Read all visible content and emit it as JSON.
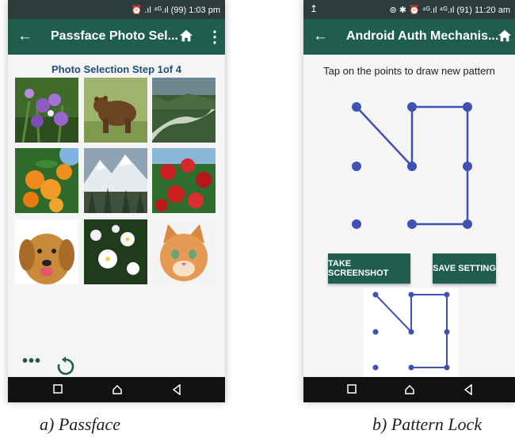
{
  "passface": {
    "status_text": "⏰ .ıl ⁴ᴳ.ıl (99) 1:03 pm",
    "title": "Passface Photo Sel...",
    "step_title": "Photo Selection Step 1of 4",
    "photos": [
      "purple-flowers",
      "bear",
      "river-valley",
      "oranges",
      "snowy-mountains",
      "red-apples",
      "dog",
      "white-flowers",
      "kitten"
    ],
    "more_icon": "ellipsis-icon",
    "refresh_icon": "refresh-icon",
    "caption": "a) Passface"
  },
  "pattern": {
    "status_text": "⊚ ✱ ⏰ ⁴ᴳ.ıl ⁴ᴳ.ıl (91) 11:20 am",
    "title": "Android Auth Mechanis...",
    "hint": "Tap on the points to draw new pattern",
    "take_screenshot_label": "TAKE SCREENSHOT",
    "save_setting_label": "SAVE SETTING",
    "caption": "b) Pattern Lock"
  },
  "colors": {
    "appbar": "#1f5e4e",
    "pattern_line": "#3f51b5"
  }
}
